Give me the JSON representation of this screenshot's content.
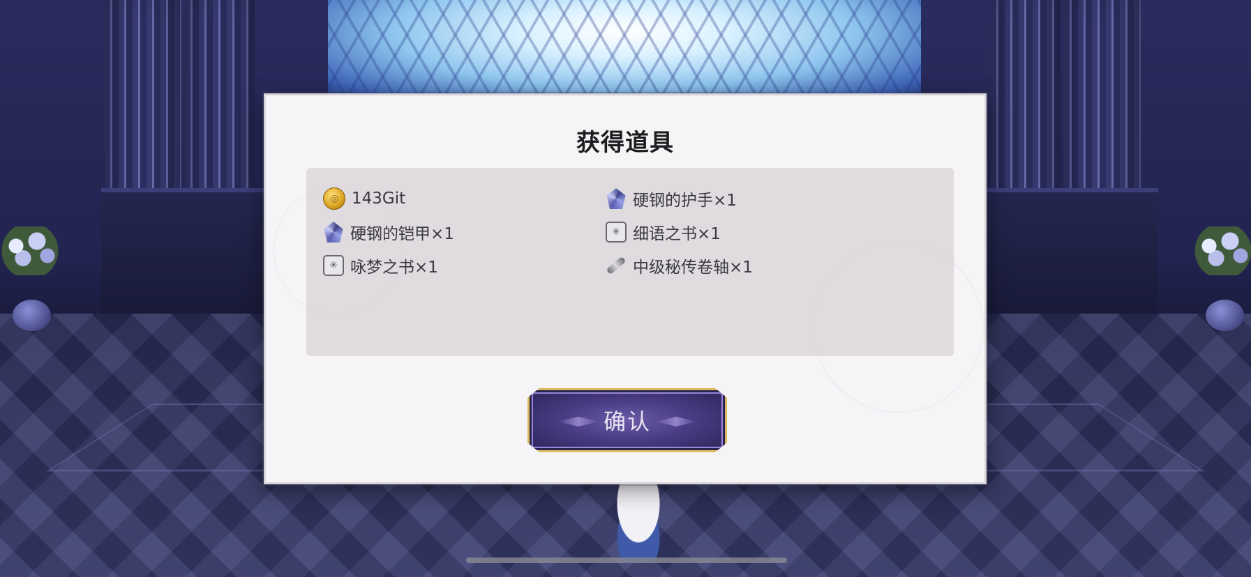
{
  "dialog": {
    "title": "获得道具",
    "confirm_label": "确认"
  },
  "items": [
    {
      "icon": "coin-icon",
      "label": "143Git"
    },
    {
      "icon": "crystal-icon",
      "label": "硬钢的护手×1"
    },
    {
      "icon": "crystal-icon",
      "label": "硬钢的铠甲×1"
    },
    {
      "icon": "book-icon",
      "label": "细语之书×1"
    },
    {
      "icon": "book-icon",
      "label": "咏梦之书×1"
    },
    {
      "icon": "scroll-icon",
      "label": "中级秘传卷轴×1"
    }
  ],
  "colors": {
    "dialog_bg": "#f6f4f7",
    "panel_bg": "#d6d1d6",
    "button_border": "#d8b960",
    "button_fill": "#4a3d85"
  }
}
